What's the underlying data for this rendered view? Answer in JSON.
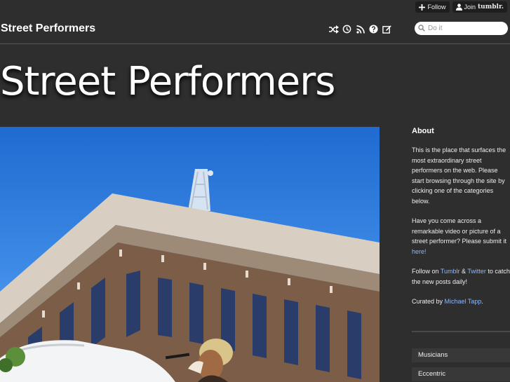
{
  "tumblr": {
    "follow_label": "Follow",
    "join_label": "Join",
    "brand": "tumblr."
  },
  "header": {
    "site_title": "Street Performers",
    "icons": [
      "shuffle-icon",
      "archive-clock-icon",
      "rss-icon",
      "help-icon",
      "edit-icon"
    ],
    "search": {
      "placeholder": "Do it",
      "value": ""
    }
  },
  "big_title": "Street Performers",
  "sidebar": {
    "about_heading": "About",
    "p1": "This is the place that surfaces the most extraordinary street performers on the web. Please start browsing through the site by clicking one of the categories below.",
    "p2_text": "Have you come across a remarkable video or picture of a street performer? Please submit it ",
    "p2_link": "here!",
    "p3_pre": "Follow on ",
    "p3_link1": "Tumblr",
    "p3_mid": " & ",
    "p3_link2": "Twitter",
    "p3_post": " to catch the new posts daily!",
    "p4_pre": "Curated by ",
    "p4_link": "Michael Tapp",
    "p4_post": ".",
    "categories": [
      "Musicians",
      "Eccentric"
    ]
  },
  "colors": {
    "background": "#2e2e2e",
    "link": "#8cb6ff",
    "sky": "#2f7ee0"
  }
}
